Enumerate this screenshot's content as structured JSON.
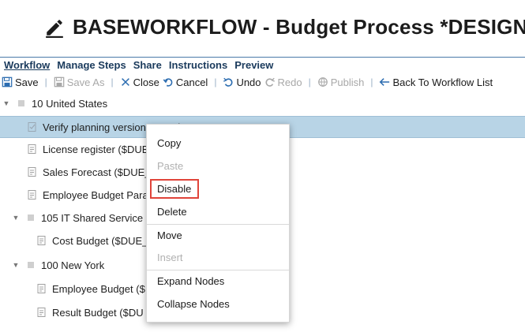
{
  "header": {
    "title": "BASEWORKFLOW - Budget Process *DESIGN",
    "icon": "pencil-icon"
  },
  "tabs": [
    {
      "label": "Workflow",
      "active": true
    },
    {
      "label": "Manage Steps",
      "active": false
    },
    {
      "label": "Share",
      "active": false
    },
    {
      "label": "Instructions",
      "active": false
    },
    {
      "label": "Preview",
      "active": false
    }
  ],
  "toolbar": {
    "save": "Save",
    "save_as": "Save As",
    "close": "Close",
    "cancel": "Cancel",
    "undo": "Undo",
    "redo": "Redo",
    "publish": "Publish",
    "back": "Back To Workflow List"
  },
  "tree": [
    {
      "label": "10 United States",
      "type": "group"
    },
    {
      "label": "Verify planning version open dates",
      "type": "task",
      "selected": true
    },
    {
      "label": "License register ($DUE",
      "type": "task"
    },
    {
      "label": "Sales Forecast ($DUE_",
      "type": "task"
    },
    {
      "label": "Employee Budget Para",
      "type": "task"
    },
    {
      "label": "105 IT Shared Service",
      "type": "group"
    },
    {
      "label": "Cost Budget ($DUE_",
      "type": "task"
    },
    {
      "label": "100 New York",
      "type": "group"
    },
    {
      "label": "Employee Budget ($",
      "type": "task"
    },
    {
      "label": "Result Budget ($DU",
      "type": "task"
    }
  ],
  "context_menu": {
    "items": [
      {
        "label": "Copy",
        "enabled": true
      },
      {
        "label": "Paste",
        "enabled": false
      },
      {
        "label": "Disable",
        "enabled": true,
        "highlighted": true
      },
      {
        "label": "Delete",
        "enabled": true
      },
      {
        "label": "Move",
        "enabled": true
      },
      {
        "label": "Insert",
        "enabled": false
      },
      {
        "label": "Expand Nodes",
        "enabled": true
      },
      {
        "label": "Collapse Nodes",
        "enabled": true
      }
    ]
  },
  "colors": {
    "selection": "#b8d4e6",
    "highlight_border": "#e0443a",
    "tab_text": "#1a3a5c",
    "divider": "#4a7aa8"
  }
}
